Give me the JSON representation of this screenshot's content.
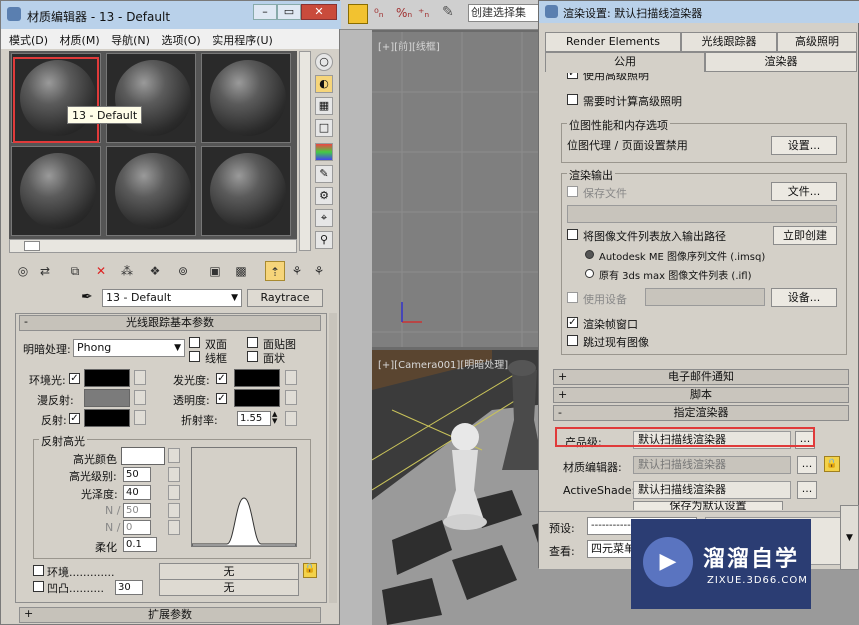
{
  "viewport": {
    "toolbar_select_label": "创建选择集",
    "top_label": "[+][前][线框]",
    "camera_label": "[+][Camera001][明暗处理]"
  },
  "mat_editor": {
    "title": "材质编辑器 - 13 - Default",
    "menu": [
      "模式(D)",
      "材质(M)",
      "导航(N)",
      "选项(O)",
      "实用程序(U)"
    ],
    "tooltip": "13 - Default",
    "material_name": "13 - Default",
    "material_type": "Raytrace",
    "rollout_basic": "光线跟踪基本参数",
    "shading_label": "明暗处理:",
    "shading_value": "Phong",
    "chk_2sided": "双面",
    "chk_facemap": "面贴图",
    "chk_wire": "线框",
    "chk_faceted": "面状",
    "ambient": "环境光:",
    "diffuse": "漫反射:",
    "reflect": "反射:",
    "luminosity": "发光度:",
    "transparency": "透明度:",
    "ior_label": "折射率:",
    "ior_value": "1.55",
    "spec_group": "反射高光",
    "spec_color": "高光颜色",
    "spec_level_label": "高光级别:",
    "spec_level": "50",
    "gloss_label": "光泽度:",
    "gloss": "40",
    "n1_label": "N /",
    "n1": "50",
    "n2_label": "N /",
    "n2": "0",
    "soften_label": "柔化",
    "soften": "0.1",
    "env_label": "环境.............",
    "env_btn": "无",
    "bump_label": "凹凸..........",
    "bump_value": "30",
    "bump_btn": "无",
    "rollout_ext": "扩展参数"
  },
  "render_setup": {
    "title": "渲染设置: 默认扫描线渲染器",
    "tabs_row1": [
      "Render Elements",
      "光线跟踪器",
      "高级照明"
    ],
    "tabs_row2": [
      "公用",
      "渲染器"
    ],
    "cut_text": "使用高级照明",
    "adv_calc": "需要时计算高级照明",
    "bitmap_group": "位图性能和内存选项",
    "bitmap_text": "位图代理 / 页面设置禁用",
    "setup_btn": "设置...",
    "output_group": "渲染输出",
    "save_file": "保存文件",
    "files_btn": "文件...",
    "put_list": "将图像文件列表放入输出路径",
    "create_now": "立即创建",
    "opt_imsq": "Autodesk ME 图像序列文件 (.imsq)",
    "opt_ifl": "原有 3ds max 图像文件列表 (.ifl)",
    "use_device": "使用设备",
    "devices_btn": "设备...",
    "frame_window": "渲染帧窗口",
    "skip_existing": "跳过现有图像",
    "rollout_email": "电子邮件通知",
    "rollout_script": "脚本",
    "rollout_assign": "指定渲染器",
    "production_label": "产品级:",
    "production_value": "默认扫描线渲染器",
    "mat_editor_label": "材质编辑器:",
    "mat_editor_value": "默认扫描线渲染器",
    "activeshade_label": "ActiveShade:",
    "activeshade_value": "默认扫描线渲染器",
    "save_default": "保存为默认设置",
    "preset_label": "预设:",
    "preset_value": "-----------",
    "view_label": "查看:",
    "view_value": "四元菜单",
    "ellipsis": "..."
  },
  "watermark": {
    "brand": "溜溜自学",
    "url": "ZIXUE.3D66.COM"
  },
  "colors": {
    "highlight_red": "#e03a3a",
    "titlebar": "#b9d1ea"
  }
}
